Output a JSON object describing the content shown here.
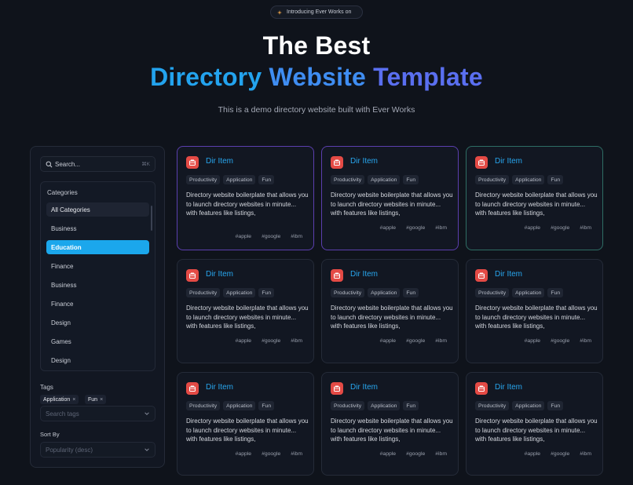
{
  "announcement": {
    "text": "Introducing Ever Works on"
  },
  "hero": {
    "title": "The Best",
    "subtitle_words": [
      "Directory",
      "Website",
      "Template"
    ],
    "tagline": "This is a demo directory website built with Ever Works"
  },
  "sidebar": {
    "search": {
      "placeholder": "Search...",
      "shortcut": "⌘K"
    },
    "categories": {
      "title": "Categories",
      "items": [
        "All Categories",
        "Business",
        "Education",
        "Finance",
        "Business",
        "Finance",
        "Design",
        "Games",
        "Design"
      ],
      "active_index": 2
    },
    "tags": {
      "label": "Tags",
      "selected": [
        "Application",
        "Fun"
      ],
      "placeholder": "Search tags"
    },
    "sort": {
      "label": "Sort By",
      "value": "Popularity (desc)"
    }
  },
  "cards": [
    {
      "title": "Dir Item",
      "categories": [
        "Productivity",
        "Application",
        "Fun"
      ],
      "description": "Directory website boilerplate that allows you to launch directory websites in minute... with features like listings,",
      "tags": [
        "#apple",
        "#google",
        "#ibm"
      ]
    },
    {
      "title": "Dir Item",
      "categories": [
        "Productivity",
        "Application",
        "Fun"
      ],
      "description": "Directory website boilerplate that allows you to launch directory websites in minute... with features like listings,",
      "tags": [
        "#apple",
        "#google",
        "#ibm"
      ]
    },
    {
      "title": "Dir Item",
      "categories": [
        "Productivity",
        "Application",
        "Fun"
      ],
      "description": "Directory website boilerplate that allows you to launch directory websites in minute... with features like listings,",
      "tags": [
        "#apple",
        "#google",
        "#ibm"
      ]
    },
    {
      "title": "Dir Item",
      "categories": [
        "Productivity",
        "Application",
        "Fun"
      ],
      "description": "Directory website boilerplate that allows you to launch directory websites in minute... with features like listings,",
      "tags": [
        "#apple",
        "#google",
        "#ibm"
      ]
    },
    {
      "title": "Dir Item",
      "categories": [
        "Productivity",
        "Application",
        "Fun"
      ],
      "description": "Directory website boilerplate that allows you to launch directory websites in minute... with features like listings,",
      "tags": [
        "#apple",
        "#google",
        "#ibm"
      ]
    },
    {
      "title": "Dir Item",
      "categories": [
        "Productivity",
        "Application",
        "Fun"
      ],
      "description": "Directory website boilerplate that allows you to launch directory websites in minute... with features like listings,",
      "tags": [
        "#apple",
        "#google",
        "#ibm"
      ]
    },
    {
      "title": "Dir Item",
      "categories": [
        "Productivity",
        "Application",
        "Fun"
      ],
      "description": "Directory website boilerplate that allows you to launch directory websites in minute... with features like listings,",
      "tags": [
        "#apple",
        "#google",
        "#ibm"
      ]
    },
    {
      "title": "Dir Item",
      "categories": [
        "Productivity",
        "Application",
        "Fun"
      ],
      "description": "Directory website boilerplate that allows you to launch directory websites in minute... with features like listings,",
      "tags": [
        "#apple",
        "#google",
        "#ibm"
      ]
    },
    {
      "title": "Dir Item",
      "categories": [
        "Productivity",
        "Application",
        "Fun"
      ],
      "description": "Directory website boilerplate that allows you to launch directory websites in minute... with features like listings,",
      "tags": [
        "#apple",
        "#google",
        "#ibm"
      ]
    }
  ],
  "icons": {
    "announcement": "sparkle-icon",
    "search": "search-icon",
    "select": "chevron-down-icon",
    "card_logo": "briefcase-icon",
    "chip_remove": "close-icon"
  },
  "colors": {
    "accent_blue": "#1ba7ec",
    "title_link": "#28a6ee",
    "logo_red": "#e44a45",
    "highlight_purple": "#5b3fae",
    "highlight_teal": "#2e6d64"
  }
}
